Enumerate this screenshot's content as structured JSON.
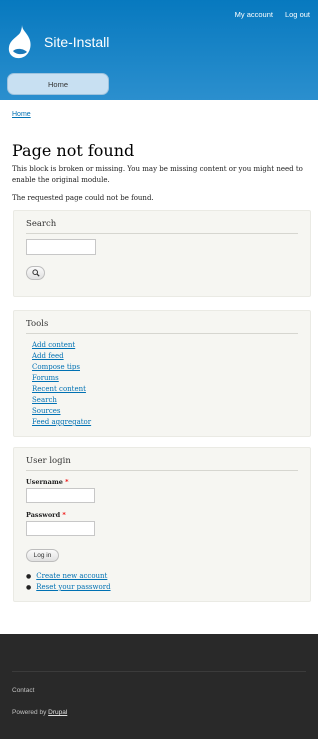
{
  "header": {
    "site_name": "Site-Install",
    "secondary_menu": [
      "My account",
      "Log out"
    ],
    "main_menu": [
      "Home"
    ]
  },
  "breadcrumb": "Home",
  "content": {
    "title": "Page not found",
    "message": "This block is broken or missing. You may be missing content or you might need to enable the original module.",
    "not_found": "The requested page could not be found."
  },
  "search_block": {
    "title": "Search",
    "input_value": "",
    "button_icon": "search-icon"
  },
  "tools_block": {
    "title": "Tools",
    "links": [
      "Add content",
      "Add feed",
      "Compose tips",
      "Forums",
      "Recent content",
      "Search",
      "Sources",
      "Feed aggregator"
    ]
  },
  "login_block": {
    "title": "User login",
    "username_label": "Username",
    "password_label": "Password",
    "required_mark": "*",
    "login_button": "Log in",
    "links": [
      "Create new account",
      "Reset your password"
    ]
  },
  "footer": {
    "contact": "Contact",
    "powered_prefix": "Powered by ",
    "powered_link": "Drupal"
  },
  "colors": {
    "header_top": "#0779bf",
    "header_bottom": "#2b8fce",
    "link": "#0071b3",
    "block_bg": "#f6f6f2",
    "footer_bg": "#292929",
    "required": "#ee0000"
  }
}
